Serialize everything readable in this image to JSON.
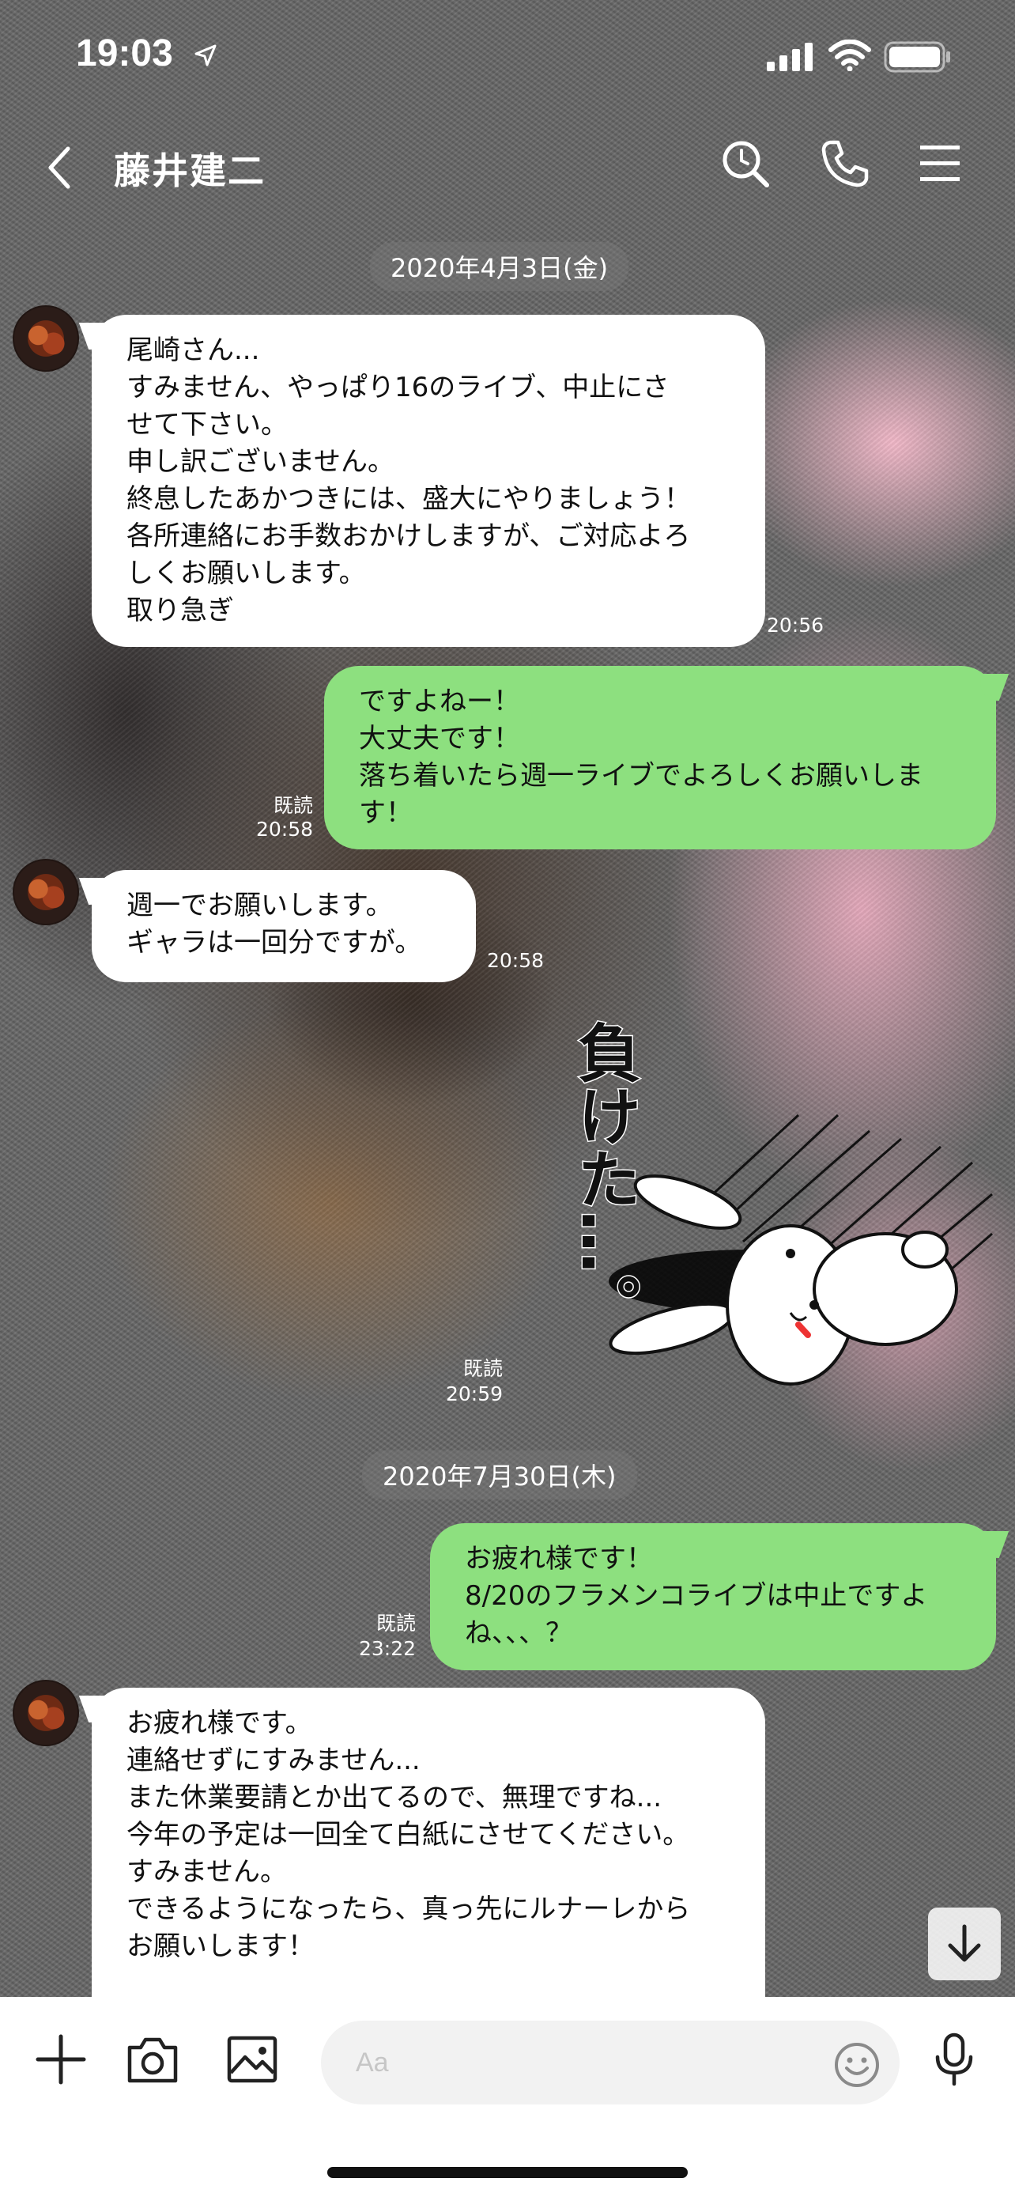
{
  "status_bar": {
    "time": "19:03"
  },
  "header": {
    "title": "藤井建二"
  },
  "messages": [
    {
      "type": "date",
      "text": "2020年4月3日(金)"
    },
    {
      "type": "in",
      "text": "尾崎さん...\nすみません、やっぱり16のライブ、中止にさ\nせて下さい。\n申し訳ございません。\n終息したあかつきには、盛大にやりましょう！\n各所連絡にお手数おかけしますが、ご対応よろ\nしくお願いします。\n取り急ぎ",
      "time": "20:56"
    },
    {
      "type": "out",
      "text": "ですよねー！\n大丈夫です！\n落ち着いたら週一ライブでよろしくお願いしま\nす！",
      "read": "既読",
      "time": "20:58"
    },
    {
      "type": "in",
      "text": "週一でお願いします。\nギャラは一回分ですが。",
      "time": "20:58"
    },
    {
      "type": "sticker",
      "text": "負けた…。",
      "read": "既読",
      "time": "20:59"
    },
    {
      "type": "date",
      "text": "2020年7月30日(木)"
    },
    {
      "type": "out",
      "text": "お疲れ様です！\n8/20のフラメンコライブは中止ですよ\nね、、、？",
      "read": "既読",
      "time": "23:22"
    },
    {
      "type": "in",
      "text": "お疲れ様です。\n連絡せずにすみません...\nまた休業要請とか出てるので、無理ですね...\n今年の予定は一回全て白紙にさせてください。\nすみません。\nできるようになったら、真っ先にルナーレから\nお願いします！"
    }
  ],
  "input": {
    "placeholder": "Aa"
  },
  "colors": {
    "outgoing_bubble": "#8de07f",
    "incoming_bubble": "#ffffff"
  }
}
